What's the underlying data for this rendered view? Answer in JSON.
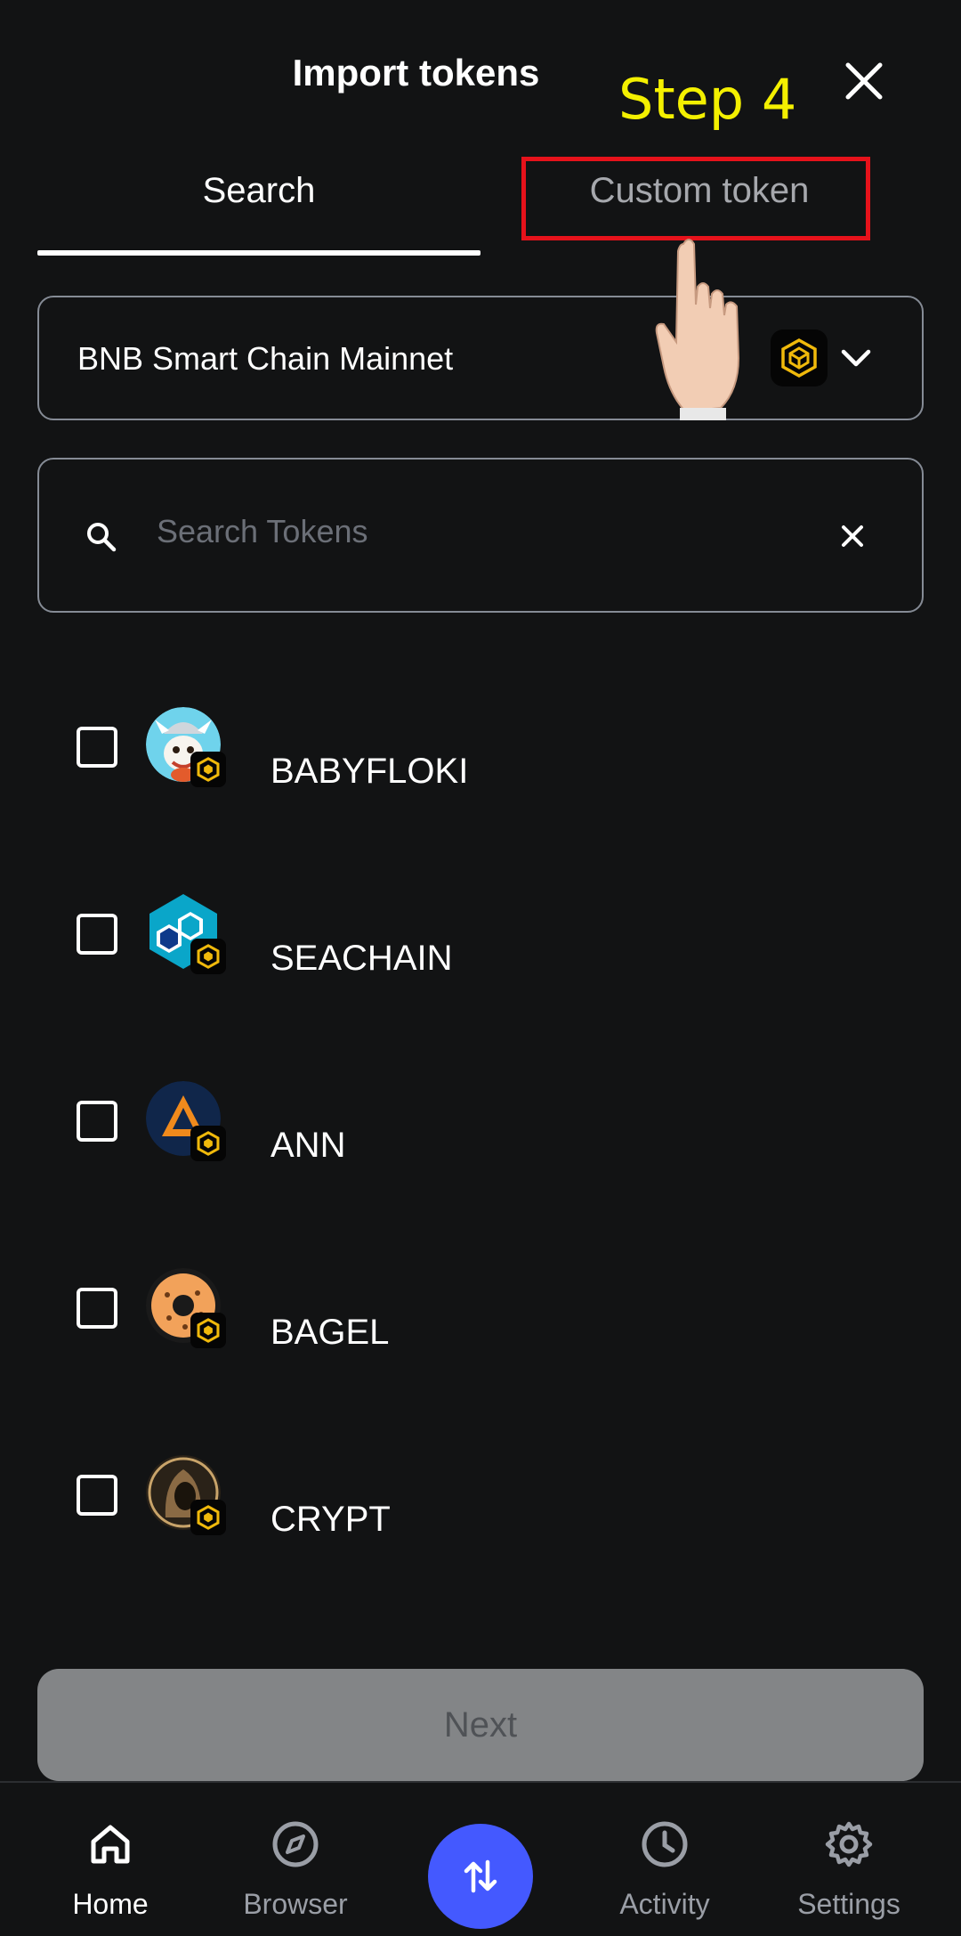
{
  "header": {
    "title": "Import tokens",
    "annotation": "Step 4"
  },
  "tabs": [
    {
      "label": "Search",
      "active": true
    },
    {
      "label": "Custom token",
      "active": false
    }
  ],
  "network": {
    "label": "BNB Smart Chain Mainnet",
    "icon": "bnb-chain-icon"
  },
  "search": {
    "placeholder": "Search Tokens",
    "value": ""
  },
  "tokens": [
    {
      "name": "BABYFLOKI",
      "checked": false
    },
    {
      "name": "SEACHAIN",
      "checked": false
    },
    {
      "name": "ANN",
      "checked": false
    },
    {
      "name": "BAGEL",
      "checked": false
    },
    {
      "name": "CRYPT",
      "checked": false
    }
  ],
  "next_button": {
    "label": "Next",
    "enabled": false
  },
  "bottom_nav": [
    {
      "label": "Home",
      "icon": "home-icon",
      "active": true
    },
    {
      "label": "Browser",
      "icon": "compass-icon",
      "active": false
    },
    {
      "label": "",
      "icon": "swap-icon",
      "active": false
    },
    {
      "label": "Activity",
      "icon": "clock-icon",
      "active": false
    },
    {
      "label": "Settings",
      "icon": "gear-icon",
      "active": false
    }
  ],
  "colors": {
    "background": "#121314",
    "accent": "#4459ff",
    "highlight": "#e6121b",
    "annotation": "#f4f000",
    "bnb": "#f0b90b"
  }
}
